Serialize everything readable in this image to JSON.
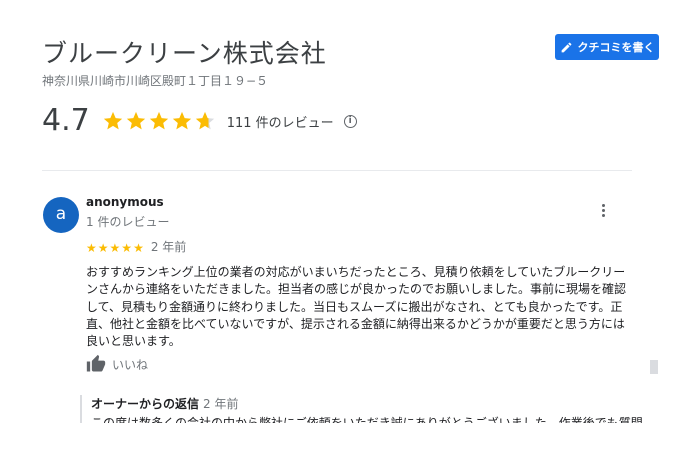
{
  "business": {
    "name": "ブルークリーン株式会社",
    "address": "神奈川県川崎市川崎区殿町１丁目１９−５"
  },
  "write_review_button": {
    "label": "クチコミを書く",
    "icon": "pencil-icon"
  },
  "summary": {
    "rating": "4.7",
    "rating_value": 4.7,
    "review_count_label": "111 件のレビュー",
    "info_icon": "i"
  },
  "review": {
    "avatar_letter": "a",
    "avatar_color": "#1565c0",
    "author": "anonymous",
    "author_meta": "1 件のレビュー",
    "stars": 5,
    "date": "2 年前",
    "text": "おすすめランキング上位の業者の対応がいまいちだったところ、見積り依頼をしていたブルークリーンさんから連絡をいただきました。担当者の感じが良かったのでお願いしました。事前に現場を確認して、見積もり金額通りに終わりました。当日もスムーズに搬出がなされ、とても良かったです。正直、他社と金額を比べていないですが、提示される金額に納得出来るかどうかが重要だと思う方には良いと思います。",
    "like_label": "いいね"
  },
  "owner_reply": {
    "title": "オーナーからの返信",
    "date": "2 年前",
    "text": "この度は数多くの会社の中から弊社にご依頼をいただき誠にありがとうございました。作業後でも質問"
  },
  "colors": {
    "accent": "#1a73e8",
    "star": "#fbbc04",
    "star_empty": "#dadce0"
  }
}
